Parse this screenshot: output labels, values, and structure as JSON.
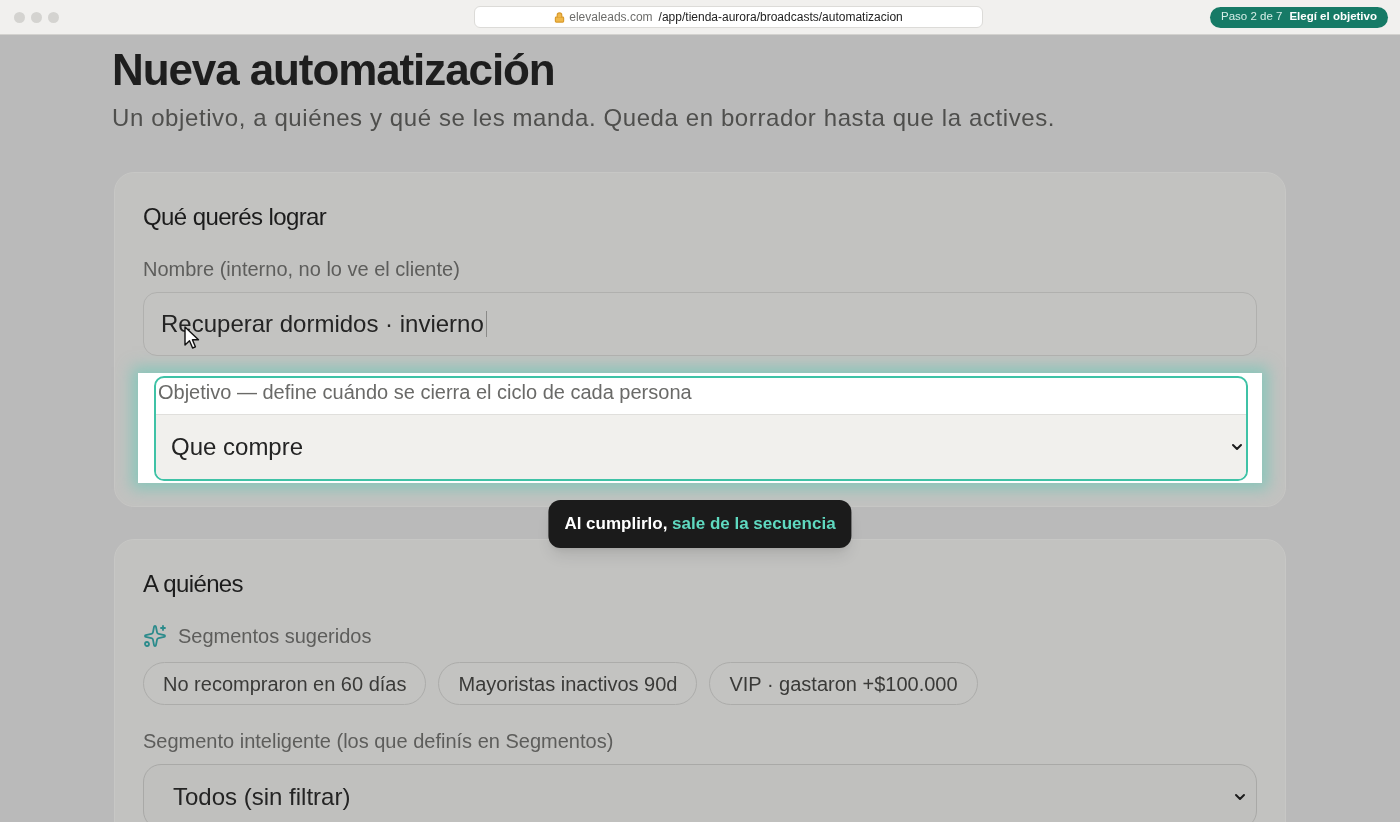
{
  "browser": {
    "domain": "elevaleads.com",
    "path": "/app/tienda-aurora/broadcasts/automatizacion",
    "step": "Paso 2 de 7",
    "step_title": "Elegí el objetivo"
  },
  "page": {
    "title": "Nueva automatización",
    "subtitle": "Un objetivo, a quiénes y qué se les manda. Queda en borrador hasta que la actives."
  },
  "sections": [
    {
      "title": "Qué querés lograr",
      "items": [
        {
          "kind": "text",
          "label": "Nombre (interno, no lo ve el cliente)",
          "value": "Recuperar dormidos · invierno",
          "highlighted": false
        },
        {
          "kind": "select",
          "label": "Objetivo — define cuándo se cierra el ciclo de cada persona",
          "value": "Que compre",
          "highlighted": true
        }
      ]
    },
    {
      "title": "A quiénes",
      "items": [
        {
          "kind": "chips",
          "label": "Segmentos sugeridos",
          "chips": [
            "No recompraron en 60 días",
            "Mayoristas inactivos 90d",
            "VIP · gastaron +$100.000"
          ]
        },
        {
          "kind": "select",
          "label": "Segmento inteligente (los que definís en Segmentos)",
          "value": "Todos (sin filtrar)",
          "highlighted": false
        }
      ]
    }
  ],
  "tooltip": {
    "text": "Al cumplirlo,",
    "highlight": "sale de la secuencia"
  }
}
